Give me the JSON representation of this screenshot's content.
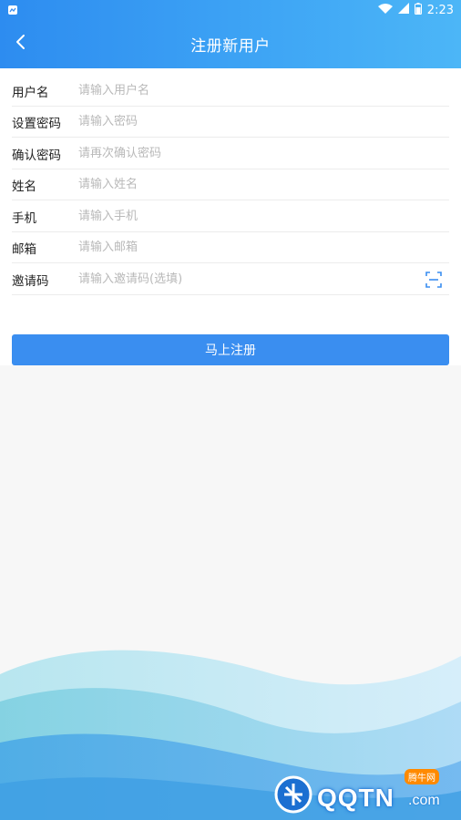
{
  "status_bar": {
    "time": "2:23"
  },
  "header": {
    "title": "注册新用户"
  },
  "form": {
    "fields": [
      {
        "label": "用户名",
        "placeholder": "请输入用户名"
      },
      {
        "label": "设置密码",
        "placeholder": "请输入密码"
      },
      {
        "label": "确认密码",
        "placeholder": "请再次确认密码"
      },
      {
        "label": "姓名",
        "placeholder": "请输入姓名"
      },
      {
        "label": "手机",
        "placeholder": "请输入手机"
      },
      {
        "label": "邮箱",
        "placeholder": "请输入邮箱"
      },
      {
        "label": "邀请码",
        "placeholder": "请输入邀请码(选填)"
      }
    ],
    "submit_label": "马上注册"
  },
  "watermark": {
    "badge": "腾牛网",
    "text": "QQTN",
    "suffix": ".com"
  },
  "colors": {
    "brand_blue": "#3a8ef0",
    "header_gradient_start": "#2d8cf0",
    "header_gradient_end": "#4cb6f7"
  },
  "icons": {
    "back": "chevron-left-icon",
    "scan": "scan-icon"
  }
}
